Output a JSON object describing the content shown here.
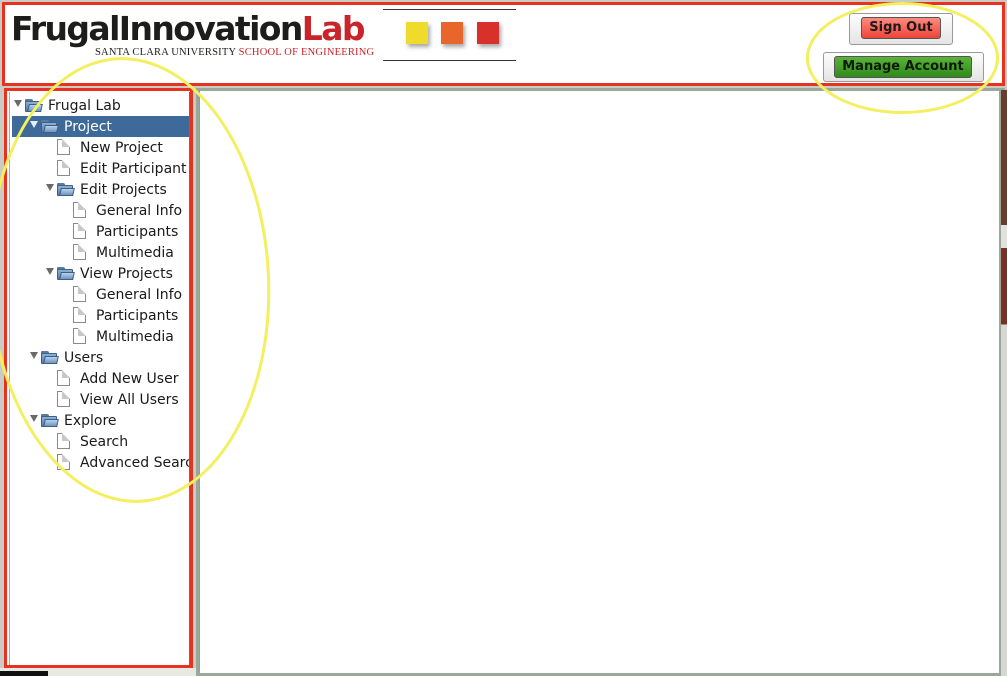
{
  "header": {
    "logo": {
      "word1": "FrugalInnovation",
      "word2": "Lab",
      "sub1": "SANTA CLARA UNIVERSITY",
      "sub2": "SCHOOL OF ENGINEERING"
    },
    "swatches": [
      "#eedb2c",
      "#e8662b",
      "#d8312b"
    ],
    "sign_out_label": "Sign Out",
    "manage_account_label": "Manage Account"
  },
  "colors": {
    "frame_red": "#e8321f",
    "annotation_yellow": "#f3ef5e",
    "selected_row": "#3d6a98",
    "sign_out": "#ee4438",
    "manage_account": "#2f8a1a"
  },
  "tree": [
    {
      "label": "Frugal Lab",
      "type": "folder",
      "depth": 0,
      "expanded": true,
      "selected": false
    },
    {
      "label": "Project",
      "type": "folder",
      "depth": 1,
      "expanded": true,
      "selected": true
    },
    {
      "label": "New Project",
      "type": "doc",
      "depth": 2,
      "selected": false
    },
    {
      "label": "Edit Participant",
      "type": "doc",
      "depth": 2,
      "selected": false
    },
    {
      "label": "Edit Projects",
      "type": "folder",
      "depth": 2,
      "expanded": true,
      "selected": false
    },
    {
      "label": "General Info",
      "type": "doc",
      "depth": 3,
      "selected": false
    },
    {
      "label": "Participants",
      "type": "doc",
      "depth": 3,
      "selected": false
    },
    {
      "label": "Multimedia",
      "type": "doc",
      "depth": 3,
      "selected": false
    },
    {
      "label": "View Projects",
      "type": "folder",
      "depth": 2,
      "expanded": true,
      "selected": false
    },
    {
      "label": "General Info",
      "type": "doc",
      "depth": 3,
      "selected": false
    },
    {
      "label": "Participants",
      "type": "doc",
      "depth": 3,
      "selected": false
    },
    {
      "label": "Multimedia",
      "type": "doc",
      "depth": 3,
      "selected": false
    },
    {
      "label": "Users",
      "type": "folder",
      "depth": 1,
      "expanded": true,
      "selected": false
    },
    {
      "label": "Add New User",
      "type": "doc",
      "depth": 2,
      "selected": false
    },
    {
      "label": "View All Users",
      "type": "doc",
      "depth": 2,
      "selected": false
    },
    {
      "label": "Explore",
      "type": "folder",
      "depth": 1,
      "expanded": true,
      "selected": false
    },
    {
      "label": "Search",
      "type": "doc",
      "depth": 2,
      "selected": false
    },
    {
      "label": "Advanced Search",
      "type": "doc",
      "depth": 2,
      "selected": false
    }
  ]
}
